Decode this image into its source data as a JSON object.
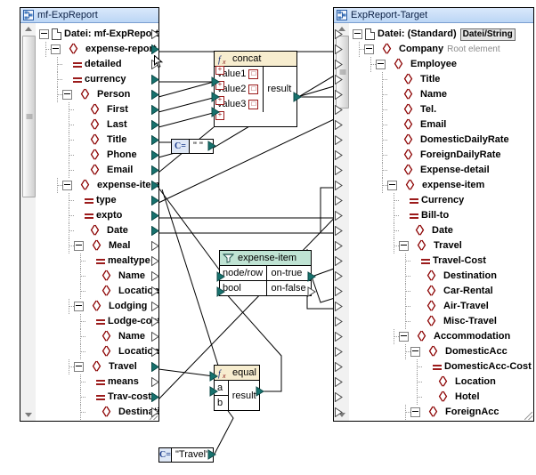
{
  "app": {
    "name": "MapForce Mapping Canvas"
  },
  "colors": {
    "title_bar_start": "#d9e8fb",
    "title_bar_end": "#bcd6f5",
    "element_icon": "#8b0000",
    "attribute_icon": "#9b1b1b",
    "connector_filled": "#17726e",
    "function_header": "#f7edcf",
    "filter_header": "#bfe3d3",
    "constant_icon_bg": "#dfe8f6"
  },
  "source_component": {
    "title": "mf-ExpReport",
    "title_icon": "mapforce-component-icon",
    "root_row": {
      "label": "Datei: mf-ExpReport",
      "icon": "file-icon"
    },
    "rows": [
      {
        "label": "expense-report",
        "icon": "element-icon",
        "indent": 1,
        "expander": true,
        "note": "e",
        "connector": "filled"
      },
      {
        "label": "detailed",
        "icon": "attribute-icon",
        "indent": 2,
        "expander": false,
        "connector": "empty"
      },
      {
        "label": "currency",
        "icon": "attribute-icon",
        "indent": 2,
        "expander": false,
        "connector": "filled"
      },
      {
        "label": "Person",
        "icon": "element-icon",
        "indent": 2,
        "expander": true,
        "connector": "filled"
      },
      {
        "label": "First",
        "icon": "element-icon",
        "indent": 3,
        "expander": false,
        "connector": "filled"
      },
      {
        "label": "Last",
        "icon": "element-icon",
        "indent": 3,
        "expander": false,
        "connector": "filled"
      },
      {
        "label": "Title",
        "icon": "element-icon",
        "indent": 3,
        "expander": false,
        "connector": "filled"
      },
      {
        "label": "Phone",
        "icon": "element-icon",
        "indent": 3,
        "expander": false,
        "connector": "filled"
      },
      {
        "label": "Email",
        "icon": "element-icon",
        "indent": 3,
        "expander": false,
        "connector": "filled"
      },
      {
        "label": "expense-item",
        "icon": "element-icon",
        "indent": 2,
        "expander": true,
        "connector": "filled"
      },
      {
        "label": "type",
        "icon": "attribute-icon",
        "indent": 3,
        "expander": false,
        "connector": "filled"
      },
      {
        "label": "expto",
        "icon": "attribute-icon",
        "indent": 3,
        "expander": false,
        "connector": "filled"
      },
      {
        "label": "Date",
        "icon": "element-icon",
        "indent": 3,
        "expander": false,
        "connector": "filled"
      },
      {
        "label": "Meal",
        "icon": "element-icon",
        "indent": 3,
        "expander": true,
        "connector": "empty"
      },
      {
        "label": "mealtype",
        "icon": "attribute-icon",
        "indent": 4,
        "expander": false,
        "connector": "empty"
      },
      {
        "label": "Name",
        "icon": "element-icon",
        "indent": 4,
        "expander": false,
        "connector": "empty"
      },
      {
        "label": "Location",
        "icon": "element-icon",
        "indent": 4,
        "expander": false,
        "connector": "empty"
      },
      {
        "label": "Lodging",
        "icon": "element-icon",
        "indent": 3,
        "expander": true,
        "connector": "empty"
      },
      {
        "label": "Lodge-cost",
        "icon": "attribute-icon",
        "indent": 4,
        "expander": false,
        "connector": "empty"
      },
      {
        "label": "Name",
        "icon": "element-icon",
        "indent": 4,
        "expander": false,
        "connector": "empty"
      },
      {
        "label": "Location",
        "icon": "element-icon",
        "indent": 4,
        "expander": false,
        "connector": "empty"
      },
      {
        "label": "Travel",
        "icon": "element-icon",
        "indent": 3,
        "expander": true,
        "connector": "filled"
      },
      {
        "label": "means",
        "icon": "attribute-icon",
        "indent": 4,
        "expander": false,
        "connector": "empty"
      },
      {
        "label": "Trav-cost",
        "icon": "attribute-icon",
        "indent": 4,
        "expander": false,
        "connector": "filled"
      },
      {
        "label": "Destination",
        "icon": "element-icon",
        "indent": 4,
        "expander": false,
        "connector": "empty"
      }
    ]
  },
  "target_component": {
    "title": "ExpReport-Target",
    "title_icon": "mapforce-component-icon",
    "root_row": {
      "label": "Datei: (Standard)",
      "icon": "file-icon",
      "button": "Datei/String"
    },
    "rows": [
      {
        "label": "Company",
        "icon": "element-icon",
        "indent": 1,
        "expander": true,
        "note": "Root element",
        "connector": "empty"
      },
      {
        "label": "Employee",
        "icon": "element-icon",
        "indent": 2,
        "expander": true,
        "connector": "empty"
      },
      {
        "label": "Title",
        "icon": "element-icon",
        "indent": 3,
        "expander": false,
        "connector": "empty"
      },
      {
        "label": "Name",
        "icon": "element-icon",
        "indent": 3,
        "expander": false,
        "connector": "empty"
      },
      {
        "label": "Tel.",
        "icon": "element-icon",
        "indent": 3,
        "expander": false,
        "connector": "empty"
      },
      {
        "label": "Email",
        "icon": "element-icon",
        "indent": 3,
        "expander": false,
        "connector": "empty"
      },
      {
        "label": "DomesticDailyRate",
        "icon": "element-icon",
        "indent": 3,
        "expander": false,
        "connector": "empty"
      },
      {
        "label": "ForeignDailyRate",
        "icon": "element-icon",
        "indent": 3,
        "expander": false,
        "connector": "empty"
      },
      {
        "label": "Expense-detail",
        "icon": "element-icon",
        "indent": 3,
        "expander": false,
        "connector": "empty"
      },
      {
        "label": "expense-item",
        "icon": "element-icon",
        "indent": 3,
        "expander": true,
        "connector": "empty"
      },
      {
        "label": "Currency",
        "icon": "attribute-icon",
        "indent": 4,
        "expander": false,
        "connector": "empty"
      },
      {
        "label": "Bill-to",
        "icon": "attribute-icon",
        "indent": 4,
        "expander": false,
        "connector": "empty"
      },
      {
        "label": "Date",
        "icon": "element-icon",
        "indent": 4,
        "expander": false,
        "connector": "empty"
      },
      {
        "label": "Travel",
        "icon": "element-icon",
        "indent": 4,
        "expander": true,
        "connector": "empty"
      },
      {
        "label": "Travel-Cost",
        "icon": "attribute-icon",
        "indent": 5,
        "expander": false,
        "connector": "empty"
      },
      {
        "label": "Destination",
        "icon": "element-icon",
        "indent": 5,
        "expander": false,
        "connector": "empty"
      },
      {
        "label": "Car-Rental",
        "icon": "element-icon",
        "indent": 5,
        "expander": false,
        "connector": "empty"
      },
      {
        "label": "Air-Travel",
        "icon": "element-icon",
        "indent": 5,
        "expander": false,
        "connector": "empty"
      },
      {
        "label": "Misc-Travel",
        "icon": "element-icon",
        "indent": 5,
        "expander": false,
        "connector": "empty"
      },
      {
        "label": "Accommodation",
        "icon": "element-icon",
        "indent": 4,
        "expander": true,
        "connector": "empty"
      },
      {
        "label": "DomesticAcc",
        "icon": "element-icon",
        "indent": 5,
        "expander": true,
        "connector": "empty"
      },
      {
        "label": "DomesticAcc-Cost",
        "icon": "attribute-icon",
        "indent": 6,
        "expander": false,
        "connector": "empty"
      },
      {
        "label": "Location",
        "icon": "element-icon",
        "indent": 6,
        "expander": false,
        "connector": "empty"
      },
      {
        "label": "Hotel",
        "icon": "element-icon",
        "indent": 6,
        "expander": false,
        "connector": "empty"
      },
      {
        "label": "ForeignAcc",
        "icon": "element-icon",
        "indent": 5,
        "expander": true,
        "connector": "empty"
      }
    ]
  },
  "functions": [
    {
      "id": "concat",
      "name": "concat",
      "icon": "fx-icon",
      "inputs": [
        "value1",
        "value2",
        "value3"
      ],
      "outputs": [
        "result"
      ],
      "removable_inputs": true
    },
    {
      "id": "filter",
      "name": "expense-item",
      "icon": "filter-icon",
      "inputs": [
        "node/row",
        "bool"
      ],
      "outputs": [
        "on-true",
        "on-false"
      ]
    },
    {
      "id": "equal",
      "name": "equal",
      "icon": "fx-icon",
      "inputs": [
        "a",
        "b"
      ],
      "outputs": [
        "result"
      ]
    }
  ],
  "constants": [
    {
      "id": "const-space",
      "icon": "constant-icon",
      "value": "\" \""
    },
    {
      "id": "const-travel",
      "icon": "constant-icon",
      "value": "\"Travel\""
    }
  ]
}
